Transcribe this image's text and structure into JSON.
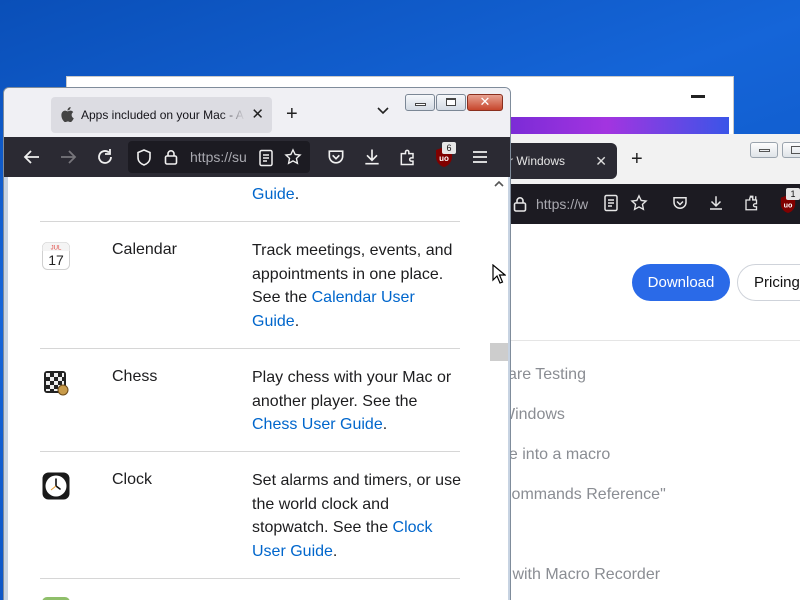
{
  "background_window_1": {},
  "background_window_2": {
    "tab_title": "r Windows",
    "url": "https://w",
    "extension_badge": "1",
    "download_label": "Download",
    "pricing_label": "Pricing",
    "menu_items": [
      "vare Testing",
      "Windows",
      "de into a macro",
      "Commands Reference\"",
      "s with Macro Recorder"
    ]
  },
  "browser": {
    "tab_title": "Apps included on your Mac - A",
    "url": "https://su",
    "extension_badge": "6"
  },
  "content": {
    "top_row": {
      "link": "Guide",
      "suffix": "."
    },
    "apps": [
      {
        "name": "Calendar",
        "icon": "calendar-icon",
        "icon_month": "JUL",
        "icon_day": "17",
        "desc_text": "Track meetings, events, and appointments in one place. See the ",
        "link": "Calendar User Guide",
        "suffix": "."
      },
      {
        "name": "Chess",
        "icon": "chess-icon",
        "desc_text": "Play chess with your Mac or another player. See the ",
        "link": "Chess User Guide",
        "suffix": "."
      },
      {
        "name": "Clock",
        "icon": "clock-icon",
        "desc_text": "Set alarms and timers, or use the world clock and stopwatch. See the ",
        "link": "Clock User Guide",
        "suffix": "."
      }
    ]
  },
  "colors": {
    "link": "#0066cc",
    "desktop": "#1565d8",
    "toolbar_dark": "#2b2a33",
    "download_button": "#2a6ae8"
  }
}
